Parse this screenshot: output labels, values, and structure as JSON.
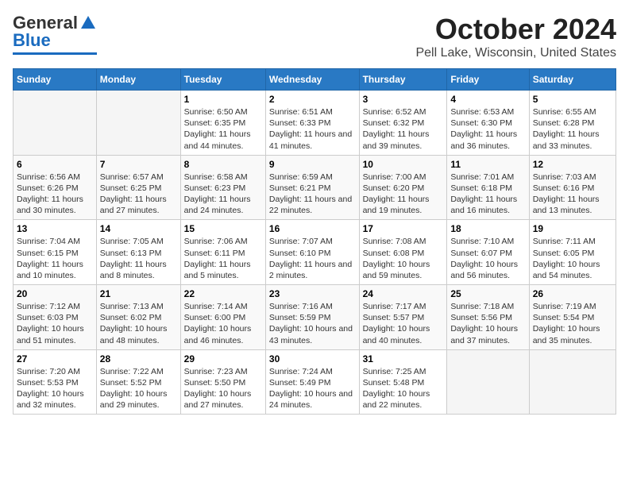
{
  "header": {
    "logo_line1": "General",
    "logo_line2": "Blue",
    "title": "October 2024",
    "subtitle": "Pell Lake, Wisconsin, United States"
  },
  "weekdays": [
    "Sunday",
    "Monday",
    "Tuesday",
    "Wednesday",
    "Thursday",
    "Friday",
    "Saturday"
  ],
  "weeks": [
    [
      {
        "day": "",
        "empty": true
      },
      {
        "day": "",
        "empty": true
      },
      {
        "day": "1",
        "sunrise": "6:50 AM",
        "sunset": "6:35 PM",
        "daylight": "11 hours and 44 minutes."
      },
      {
        "day": "2",
        "sunrise": "6:51 AM",
        "sunset": "6:33 PM",
        "daylight": "11 hours and 41 minutes."
      },
      {
        "day": "3",
        "sunrise": "6:52 AM",
        "sunset": "6:32 PM",
        "daylight": "11 hours and 39 minutes."
      },
      {
        "day": "4",
        "sunrise": "6:53 AM",
        "sunset": "6:30 PM",
        "daylight": "11 hours and 36 minutes."
      },
      {
        "day": "5",
        "sunrise": "6:55 AM",
        "sunset": "6:28 PM",
        "daylight": "11 hours and 33 minutes."
      }
    ],
    [
      {
        "day": "6",
        "sunrise": "6:56 AM",
        "sunset": "6:26 PM",
        "daylight": "11 hours and 30 minutes."
      },
      {
        "day": "7",
        "sunrise": "6:57 AM",
        "sunset": "6:25 PM",
        "daylight": "11 hours and 27 minutes."
      },
      {
        "day": "8",
        "sunrise": "6:58 AM",
        "sunset": "6:23 PM",
        "daylight": "11 hours and 24 minutes."
      },
      {
        "day": "9",
        "sunrise": "6:59 AM",
        "sunset": "6:21 PM",
        "daylight": "11 hours and 22 minutes."
      },
      {
        "day": "10",
        "sunrise": "7:00 AM",
        "sunset": "6:20 PM",
        "daylight": "11 hours and 19 minutes."
      },
      {
        "day": "11",
        "sunrise": "7:01 AM",
        "sunset": "6:18 PM",
        "daylight": "11 hours and 16 minutes."
      },
      {
        "day": "12",
        "sunrise": "7:03 AM",
        "sunset": "6:16 PM",
        "daylight": "11 hours and 13 minutes."
      }
    ],
    [
      {
        "day": "13",
        "sunrise": "7:04 AM",
        "sunset": "6:15 PM",
        "daylight": "11 hours and 10 minutes."
      },
      {
        "day": "14",
        "sunrise": "7:05 AM",
        "sunset": "6:13 PM",
        "daylight": "11 hours and 8 minutes."
      },
      {
        "day": "15",
        "sunrise": "7:06 AM",
        "sunset": "6:11 PM",
        "daylight": "11 hours and 5 minutes."
      },
      {
        "day": "16",
        "sunrise": "7:07 AM",
        "sunset": "6:10 PM",
        "daylight": "11 hours and 2 minutes."
      },
      {
        "day": "17",
        "sunrise": "7:08 AM",
        "sunset": "6:08 PM",
        "daylight": "10 hours and 59 minutes."
      },
      {
        "day": "18",
        "sunrise": "7:10 AM",
        "sunset": "6:07 PM",
        "daylight": "10 hours and 56 minutes."
      },
      {
        "day": "19",
        "sunrise": "7:11 AM",
        "sunset": "6:05 PM",
        "daylight": "10 hours and 54 minutes."
      }
    ],
    [
      {
        "day": "20",
        "sunrise": "7:12 AM",
        "sunset": "6:03 PM",
        "daylight": "10 hours and 51 minutes."
      },
      {
        "day": "21",
        "sunrise": "7:13 AM",
        "sunset": "6:02 PM",
        "daylight": "10 hours and 48 minutes."
      },
      {
        "day": "22",
        "sunrise": "7:14 AM",
        "sunset": "6:00 PM",
        "daylight": "10 hours and 46 minutes."
      },
      {
        "day": "23",
        "sunrise": "7:16 AM",
        "sunset": "5:59 PM",
        "daylight": "10 hours and 43 minutes."
      },
      {
        "day": "24",
        "sunrise": "7:17 AM",
        "sunset": "5:57 PM",
        "daylight": "10 hours and 40 minutes."
      },
      {
        "day": "25",
        "sunrise": "7:18 AM",
        "sunset": "5:56 PM",
        "daylight": "10 hours and 37 minutes."
      },
      {
        "day": "26",
        "sunrise": "7:19 AM",
        "sunset": "5:54 PM",
        "daylight": "10 hours and 35 minutes."
      }
    ],
    [
      {
        "day": "27",
        "sunrise": "7:20 AM",
        "sunset": "5:53 PM",
        "daylight": "10 hours and 32 minutes."
      },
      {
        "day": "28",
        "sunrise": "7:22 AM",
        "sunset": "5:52 PM",
        "daylight": "10 hours and 29 minutes."
      },
      {
        "day": "29",
        "sunrise": "7:23 AM",
        "sunset": "5:50 PM",
        "daylight": "10 hours and 27 minutes."
      },
      {
        "day": "30",
        "sunrise": "7:24 AM",
        "sunset": "5:49 PM",
        "daylight": "10 hours and 24 minutes."
      },
      {
        "day": "31",
        "sunrise": "7:25 AM",
        "sunset": "5:48 PM",
        "daylight": "10 hours and 22 minutes."
      },
      {
        "day": "",
        "empty": true
      },
      {
        "day": "",
        "empty": true
      }
    ]
  ]
}
